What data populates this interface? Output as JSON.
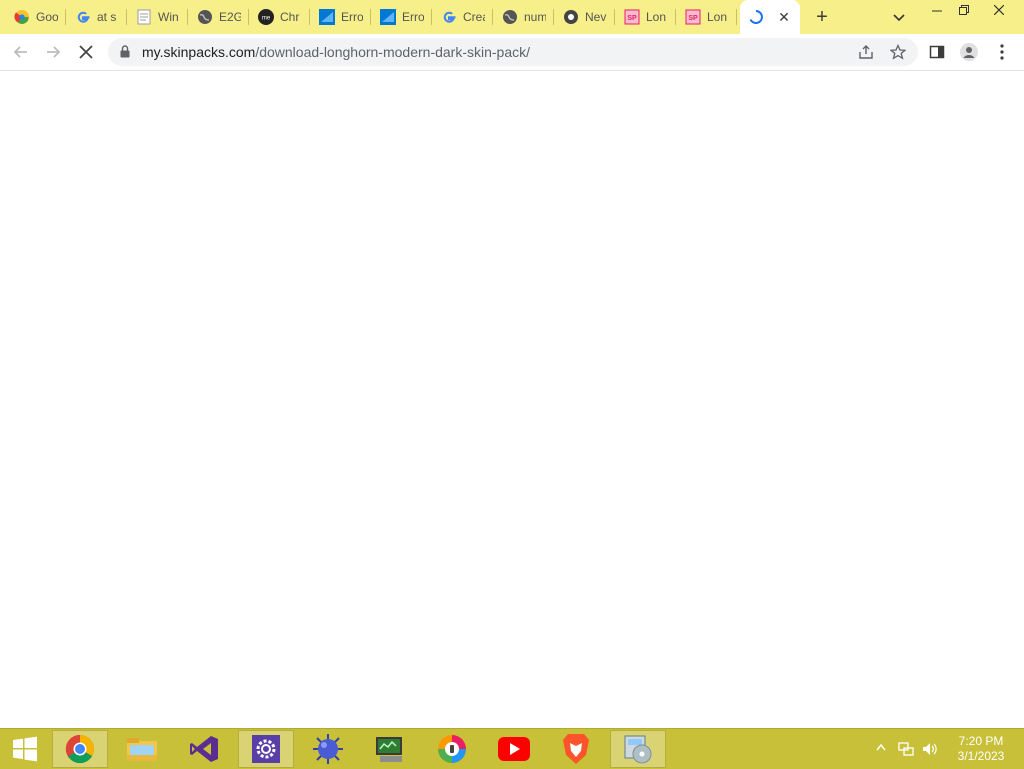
{
  "browser": {
    "tabs": [
      {
        "title": "Goo",
        "icon": "chrome-web-store-icon",
        "color": "#e53935"
      },
      {
        "title": "at s",
        "icon": "google-g-icon",
        "color": "#4285f4"
      },
      {
        "title": "Win",
        "icon": "page-icon",
        "color": "#9e9e9e"
      },
      {
        "title": "E2G",
        "icon": "globe-icon",
        "color": "#555555"
      },
      {
        "title": "Chr",
        "icon": "me-icon",
        "color": "#222222"
      },
      {
        "title": "Erro",
        "icon": "azure-icon",
        "color": "#0078d4"
      },
      {
        "title": "Erro",
        "icon": "azure-icon",
        "color": "#0078d4"
      },
      {
        "title": "Crea",
        "icon": "google-g-icon",
        "color": "#4285f4"
      },
      {
        "title": "num",
        "icon": "globe-icon",
        "color": "#555555"
      },
      {
        "title": "Nev",
        "icon": "chromium-icon",
        "color": "#444444"
      },
      {
        "title": "Lon",
        "icon": "skinpacks-icon",
        "color": "#e91e63"
      },
      {
        "title": "Lon",
        "icon": "skinpacks-icon",
        "color": "#e91e63"
      }
    ],
    "active_tab": {
      "title": "",
      "icon": "loading-spinner-icon"
    },
    "close_glyph": "✕",
    "new_tab_glyph": "+",
    "url": {
      "host": "my.skinpacks.com",
      "path": "/download-longhorn-modern-dark-skin-pack/"
    }
  },
  "taskbar": {
    "clock_time": "7:20 PM",
    "clock_date": "3/1/2023"
  },
  "colors": {
    "tabstrip": "#f7ef8a",
    "taskbar": "#c9c039"
  }
}
